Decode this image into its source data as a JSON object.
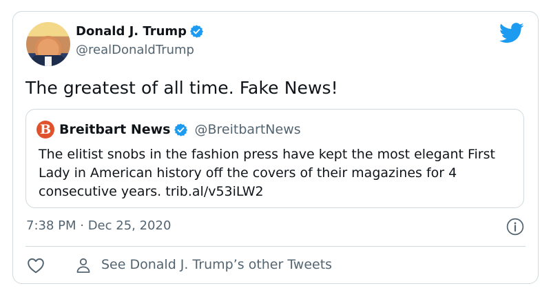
{
  "author": {
    "name": "Donald J. Trump",
    "handle": "@realDonaldTrump",
    "verified": true,
    "avatar": "profile-photo"
  },
  "tweet": {
    "text": "The greatest of all time. Fake News!",
    "timestamp": "7:38 PM · Dec 25, 2020"
  },
  "quoted_tweet": {
    "logo_letter": "B",
    "name": "Breitbart News",
    "handle": "@BreitbartNews",
    "verified": true,
    "text": "The elitist snobs in the fashion press have kept the most elegant First Lady in American history off the covers of their magazines for 4 consecutive years.  trib.al/v53iLW2"
  },
  "footer": {
    "other_tweets_label": "See Donald J. Trump’s other Tweets"
  },
  "icons": [
    "twitter-bird-icon",
    "verified-badge-icon",
    "info-icon",
    "heart-icon",
    "person-icon"
  ],
  "colors": {
    "twitter_blue": "#1d9bf0",
    "breitbart_orange": "#e0522b",
    "secondary_text": "#536471",
    "border": "#cfd9de"
  }
}
